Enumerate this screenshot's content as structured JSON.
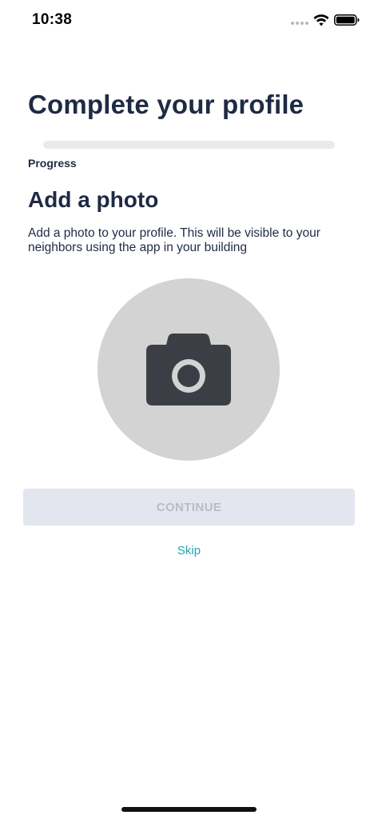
{
  "status_bar": {
    "time": "10:38",
    "icons": [
      "cellular-dots-icon",
      "wifi-icon",
      "battery-icon"
    ]
  },
  "page": {
    "title": "Complete your profile"
  },
  "progress": {
    "label": "Progress",
    "value": 0
  },
  "step": {
    "title": "Add a photo",
    "description": "Add a photo to your profile. This will be visible to your neighbors using the app in your building",
    "photo_placeholder_icon": "camera-icon"
  },
  "actions": {
    "continue_label": "CONTINUE",
    "continue_enabled": false,
    "skip_label": "Skip"
  },
  "colors": {
    "text_primary": "#1f2a44",
    "accent": "#27a4ad",
    "button_disabled_bg": "#e3e6ef",
    "button_disabled_text": "#b8bcc7",
    "photo_placeholder_bg": "#d3d3d3",
    "camera_icon": "#3b3f45"
  }
}
